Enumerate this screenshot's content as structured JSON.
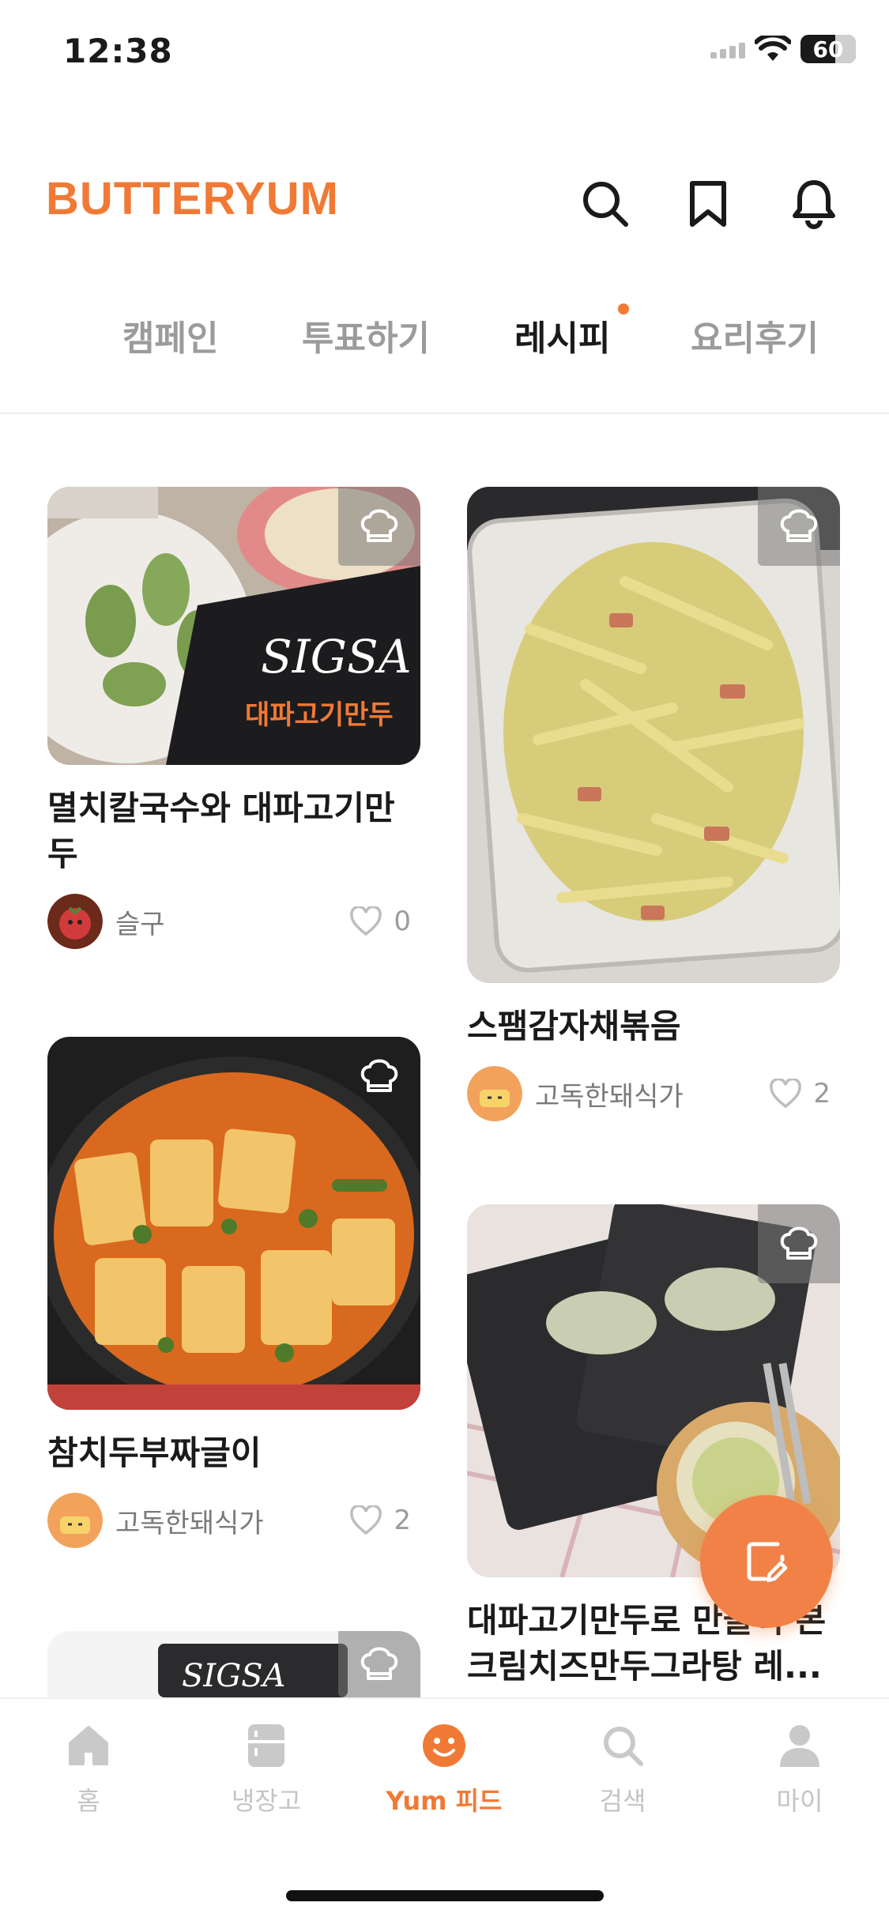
{
  "status_bar": {
    "time": "12:38",
    "battery": "60"
  },
  "header": {
    "logo": "BUTTERYUM"
  },
  "tabs": [
    {
      "label": "캠페인"
    },
    {
      "label": "투표하기"
    },
    {
      "label": "레시피"
    },
    {
      "label": "요리후기"
    }
  ],
  "feed": [
    {
      "title": "멸치칼국수와 대파고기만두",
      "author": "슬구",
      "likes": "0"
    },
    {
      "title": "스팸감자채볶음",
      "author": "고독한돼식가",
      "likes": "2"
    },
    {
      "title": "참치두부짜글이",
      "author": "고독한돼식가",
      "likes": "2"
    },
    {
      "title": "대파고기만두로 만들어 본 크림치즈만두그라탕 레...",
      "author": "",
      "likes": ""
    }
  ],
  "bottom_nav": [
    {
      "label": "홈",
      "icon": "home-icon"
    },
    {
      "label": "냉장고",
      "icon": "fridge-icon"
    },
    {
      "label": "Yum 피드",
      "icon": "yum-smile-icon"
    },
    {
      "label": "검색",
      "icon": "search-icon"
    },
    {
      "label": "마이",
      "icon": "person-icon"
    }
  ],
  "colors": {
    "brand": "#f07a35",
    "inactive": "#c4c4c4",
    "tab_inactive": "#9b9b9b"
  }
}
